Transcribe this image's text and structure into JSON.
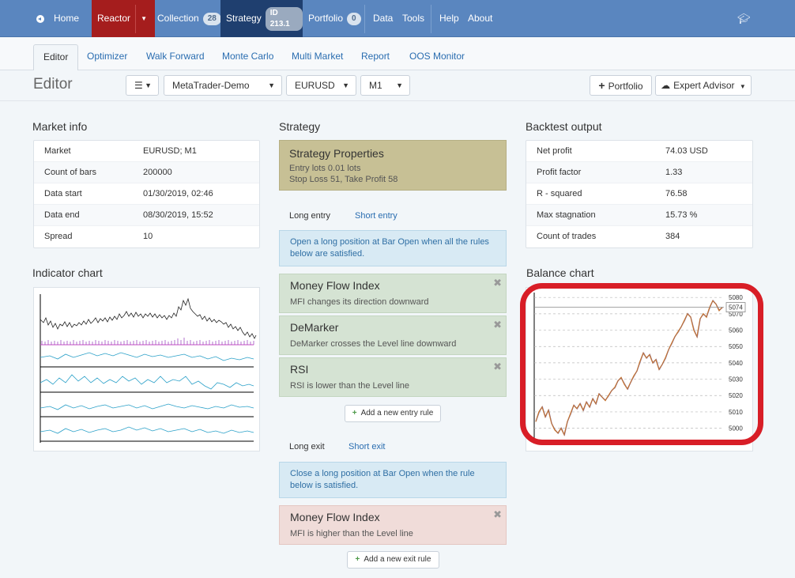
{
  "topnav": {
    "home": "Home",
    "reactor": "Reactor",
    "collection": "Collection",
    "collection_count": "28",
    "strategy": "Strategy",
    "strategy_id": "ID 213.1",
    "portfolio": "Portfolio",
    "portfolio_count": "0",
    "data": "Data",
    "tools": "Tools",
    "help": "Help",
    "about": "About"
  },
  "subnav": [
    "Editor",
    "Optimizer",
    "Walk Forward",
    "Monte Carlo",
    "Multi Market",
    "Report",
    "OOS Monitor"
  ],
  "toolbar": {
    "title": "Editor",
    "server": "MetaTrader-Demo",
    "symbol": "EURUSD",
    "period": "M1",
    "portfolio_btn": "Portfolio",
    "ea_btn": "Expert Advisor"
  },
  "market_info": {
    "title": "Market info",
    "rows": [
      {
        "k": "Market",
        "v": "EURUSD; M1"
      },
      {
        "k": "Count of bars",
        "v": "200000"
      },
      {
        "k": "Data start",
        "v": "01/30/2019, 02:46"
      },
      {
        "k": "Data end",
        "v": "08/30/2019, 15:52"
      },
      {
        "k": "Spread",
        "v": "10"
      }
    ]
  },
  "indicator_chart": {
    "title": "Indicator chart"
  },
  "strategy": {
    "title": "Strategy",
    "props_title": "Strategy Properties",
    "props_line1": "Entry lots 0.01 lots",
    "props_line2": "Stop Loss 51, Take Profit 58",
    "long_entry": "Long entry",
    "short_entry": "Short entry",
    "entry_info": "Open a long position at Bar Open when all the rules below are satisfied.",
    "entry_rules": [
      {
        "title": "Money Flow Index",
        "desc": "MFI changes its direction downward"
      },
      {
        "title": "DeMarker",
        "desc": "DeMarker crosses the Level line downward"
      },
      {
        "title": "RSI",
        "desc": "RSI is lower than the Level line"
      }
    ],
    "add_entry": "Add a new entry rule",
    "long_exit": "Long exit",
    "short_exit": "Short exit",
    "exit_info": "Close a long position at Bar Open when the rule below is satisfied.",
    "exit_rule": {
      "title": "Money Flow Index",
      "desc": "MFI is higher than the Level line"
    },
    "add_exit": "Add a new exit rule"
  },
  "backtest": {
    "title": "Backtest output",
    "rows": [
      {
        "k": "Net profit",
        "v": "74.03 USD"
      },
      {
        "k": "Profit factor",
        "v": "1.33"
      },
      {
        "k": "R - squared",
        "v": "76.58"
      },
      {
        "k": "Max stagnation",
        "v": "15.73 %"
      },
      {
        "k": "Count of trades",
        "v": "384"
      }
    ]
  },
  "balance_chart": {
    "title": "Balance chart",
    "current_label": "5074",
    "chart_data": {
      "type": "line",
      "y_ticks": [
        5080,
        5070,
        5060,
        5050,
        5040,
        5030,
        5020,
        5010,
        5000
      ],
      "ylim": [
        4994,
        5083
      ],
      "current": 5074,
      "values": [
        5004,
        5010,
        5013,
        5007,
        5011,
        5003,
        4999,
        4997,
        5000,
        4996,
        5004,
        5009,
        5014,
        5012,
        5015,
        5011,
        5016,
        5013,
        5018,
        5015,
        5021,
        5019,
        5017,
        5020,
        5023,
        5025,
        5029,
        5031,
        5027,
        5024,
        5028,
        5032,
        5035,
        5041,
        5046,
        5043,
        5045,
        5040,
        5042,
        5036,
        5039,
        5043,
        5048,
        5052,
        5056,
        5059,
        5062,
        5066,
        5070,
        5068,
        5060,
        5056,
        5067,
        5070,
        5068,
        5074,
        5078,
        5076,
        5072,
        5074
      ]
    }
  },
  "colors": {
    "nav": "#5a86bf",
    "reactor": "#a51d1d",
    "strategy_nav": "#1f3f6f",
    "highlight_ring": "#d81e27",
    "balance_line": "#c4722e",
    "balance_line2": "#6a5da8"
  }
}
